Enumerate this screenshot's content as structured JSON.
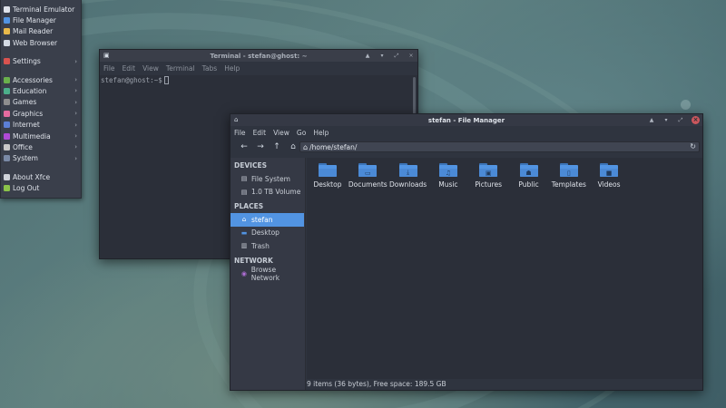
{
  "desktop": {
    "accent": "#5294e2"
  },
  "app_menu": {
    "items": [
      {
        "label": "Terminal Emulator",
        "icon": "terminal-icon",
        "color": "#dfe3ea",
        "submenu": false
      },
      {
        "label": "File Manager",
        "icon": "folder-icon",
        "color": "#5294e2",
        "submenu": false
      },
      {
        "label": "Mail Reader",
        "icon": "mail-icon",
        "color": "#e8b94a",
        "submenu": false
      },
      {
        "label": "Web Browser",
        "icon": "globe-icon",
        "color": "#d3dae3",
        "submenu": false
      },
      {
        "label": "Settings",
        "icon": "settings-icon",
        "color": "#d9534f",
        "submenu": true
      },
      {
        "label": "Accessories",
        "icon": "accessories-icon",
        "color": "#6ab04c",
        "submenu": true
      },
      {
        "label": "Education",
        "icon": "education-icon",
        "color": "#4caf8a",
        "submenu": true
      },
      {
        "label": "Games",
        "icon": "gamepad-icon",
        "color": "#8e8e8e",
        "submenu": true
      },
      {
        "label": "Graphics",
        "icon": "graphics-icon",
        "color": "#e56b9f",
        "submenu": true
      },
      {
        "label": "Internet",
        "icon": "internet-icon",
        "color": "#5c7fd6",
        "submenu": true
      },
      {
        "label": "Multimedia",
        "icon": "multimedia-icon",
        "color": "#b04ad6",
        "submenu": true
      },
      {
        "label": "Office",
        "icon": "office-icon",
        "color": "#c8c8c8",
        "submenu": true
      },
      {
        "label": "System",
        "icon": "system-icon",
        "color": "#7a8aa6",
        "submenu": true
      },
      {
        "label": "About Xfce",
        "icon": "info-icon",
        "color": "#cfd3d9",
        "submenu": false
      },
      {
        "label": "Log Out",
        "icon": "logout-icon",
        "color": "#8bc34a",
        "submenu": false
      }
    ]
  },
  "terminal": {
    "title": "Terminal - stefan@ghost: ~",
    "menu": [
      "File",
      "Edit",
      "View",
      "Terminal",
      "Tabs",
      "Help"
    ],
    "prompt": "stefan@ghost:~$"
  },
  "file_manager": {
    "title": "stefan - File Manager",
    "menu": [
      "File",
      "Edit",
      "View",
      "Go",
      "Help"
    ],
    "path": "/home/stefan/",
    "sidebar": {
      "devices_heading": "DEVICES",
      "devices": [
        {
          "label": "File System",
          "icon": "drive-icon"
        },
        {
          "label": "1.0 TB Volume",
          "icon": "drive-icon"
        }
      ],
      "places_heading": "PLACES",
      "places": [
        {
          "label": "stefan",
          "icon": "home-icon",
          "selected": true
        },
        {
          "label": "Desktop",
          "icon": "desktop-icon",
          "selected": false
        },
        {
          "label": "Trash",
          "icon": "trash-icon",
          "selected": false
        }
      ],
      "network_heading": "NETWORK",
      "network": [
        {
          "label": "Browse Network",
          "icon": "network-icon"
        }
      ]
    },
    "files": [
      {
        "label": "Desktop",
        "icon": "desktop-folder-icon",
        "glyph": ""
      },
      {
        "label": "Documents",
        "icon": "documents-folder-icon",
        "glyph": "▭"
      },
      {
        "label": "Downloads",
        "icon": "downloads-folder-icon",
        "glyph": "⤓"
      },
      {
        "label": "Music",
        "icon": "music-folder-icon",
        "glyph": "♫"
      },
      {
        "label": "Pictures",
        "icon": "pictures-folder-icon",
        "glyph": "▣"
      },
      {
        "label": "Public",
        "icon": "public-folder-icon",
        "glyph": "☗"
      },
      {
        "label": "Templates",
        "icon": "templates-folder-icon",
        "glyph": "▯"
      },
      {
        "label": "Videos",
        "icon": "videos-folder-icon",
        "glyph": "■"
      }
    ],
    "status": "9 items (36 bytes), Free space: 189.5 GB"
  }
}
